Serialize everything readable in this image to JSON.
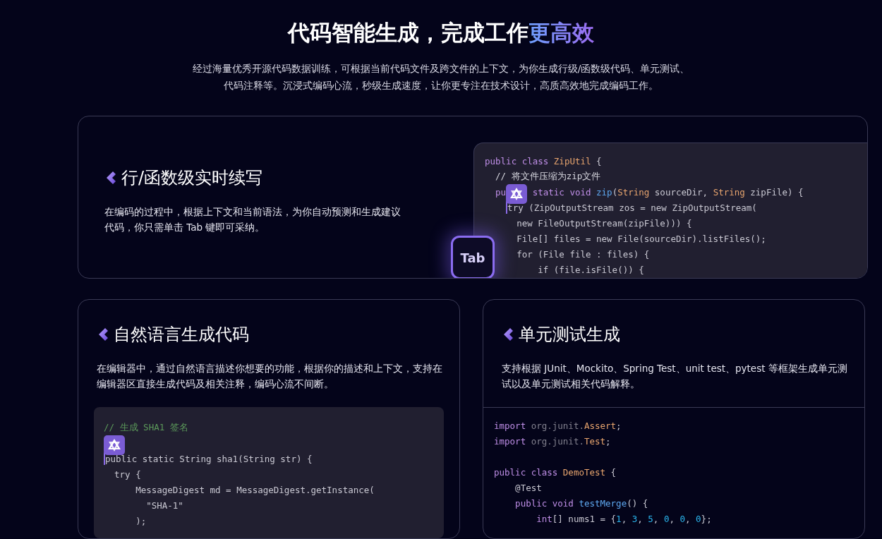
{
  "hero": {
    "title_parts": [
      {
        "text": "代码智能生成，完成工作",
        "highlight": false
      },
      {
        "text": "更高效",
        "highlight": true
      }
    ],
    "subtitle_lines": [
      "经过海量优秀开源代码数据训练，可根据当前代码文件及跨文件的上下文，为你生成行级/函数级代码、单元测试、",
      "代码注释等。沉浸式编码心流，秒级生成速度，让你更专注在技术设计，高质高效地完成编码工作。"
    ]
  },
  "feature_main": {
    "title": "行/函数级实时续写",
    "description": "在编码的过程中，根据上下文和当前语法，为你自动预测和生成建议代码，你只需单击 Tab 键即可采纳。",
    "key_label": "Tab",
    "code": [
      {
        "lines": [
          {
            "tokens": [
              {
                "text": "public class ",
                "kind": "kw"
              },
              {
                "text": "ZipUtil",
                "kind": "type"
              },
              {
                "text": " {",
                "kind": "plain"
              }
            ]
          },
          {
            "tokens": [
              {
                "text": "  // 将文件压缩为zip文件",
                "kind": "note"
              }
            ]
          },
          {
            "tokens": [
              {
                "text": "  pu",
                "kind": "kw"
              },
              {
                "kind": "badge"
              },
              {
                "text": " static void ",
                "kind": "kw"
              },
              {
                "text": "zip",
                "kind": "fn"
              },
              {
                "text": "(",
                "kind": "plain"
              },
              {
                "text": "String",
                "kind": "type"
              },
              {
                "text": " sourceDir, ",
                "kind": "plain"
              },
              {
                "text": "String",
                "kind": "type"
              },
              {
                "text": " zipFile) {",
                "kind": "plain"
              }
            ]
          },
          {
            "tokens": [
              {
                "text": "    try (ZipOutputStream zos = new ZipOutputStream(",
                "kind": "caret"
              }
            ]
          },
          {
            "tokens": [
              {
                "text": "      new FileOutputStream(zipFile))) {",
                "kind": "plain"
              }
            ]
          },
          {
            "tokens": [
              {
                "text": "      File[] files = new File(sourceDir).listFiles();",
                "kind": "plain"
              }
            ]
          },
          {
            "tokens": [
              {
                "text": "      for (File file : files) {",
                "kind": "plain"
              }
            ]
          },
          {
            "tokens": [
              {
                "text": "          if (file.isFile()) {",
                "kind": "plain"
              }
            ]
          }
        ]
      }
    ]
  },
  "features": [
    {
      "title": "自然语言生成代码",
      "description": "在编辑器中，通过自然语言描述你想要的功能，根据你的描述和上下文，支持在编辑器区直接生成代码及相关注释，编码心流不间断。",
      "kind": "panel",
      "code": [
        {
          "lines": [
            {
              "tokens": [
                {
                  "text": "// 生成 SHA1 签名",
                  "kind": "comment"
                }
              ]
            },
            {
              "tokens": [
                {
                  "kind": "badge"
                }
              ]
            },
            {
              "tokens": [
                {
                  "text": "public static String sha1(String str) {",
                  "kind": "caret"
                }
              ]
            },
            {
              "tokens": [
                {
                  "text": "  try {",
                  "kind": "plain"
                }
              ]
            },
            {
              "tokens": [
                {
                  "text": "      MessageDigest md = MessageDigest.getInstance(",
                  "kind": "plain"
                }
              ]
            },
            {
              "tokens": [
                {
                  "text": "        \"SHA-1\"",
                  "kind": "plain"
                }
              ]
            },
            {
              "tokens": [
                {
                  "text": "      );",
                  "kind": "plain"
                }
              ]
            }
          ]
        }
      ]
    },
    {
      "title": "单元测试生成",
      "description": "支持根据 JUnit、Mockito、Spring Test、unit test、pytest 等框架生成单元测试以及单元测试相关代码解释。",
      "kind": "divided",
      "code": [
        {
          "lines": [
            {
              "tokens": [
                {
                  "text": "import ",
                  "kind": "kw"
                },
                {
                  "text": "org.junit.",
                  "kind": "dim"
                },
                {
                  "text": "Assert",
                  "kind": "type"
                },
                {
                  "text": ";",
                  "kind": "plain"
                }
              ]
            },
            {
              "tokens": [
                {
                  "text": "import ",
                  "kind": "kw"
                },
                {
                  "text": "org.junit.",
                  "kind": "dim"
                },
                {
                  "text": "Test",
                  "kind": "type"
                },
                {
                  "text": ";",
                  "kind": "plain"
                }
              ]
            }
          ]
        },
        {
          "lines": [
            {
              "tokens": [
                {
                  "text": "public class ",
                  "kind": "kw"
                },
                {
                  "text": "DemoTest",
                  "kind": "type"
                },
                {
                  "text": " {",
                  "kind": "plain"
                }
              ]
            },
            {
              "tokens": [
                {
                  "text": "    @Test",
                  "kind": "plain"
                }
              ]
            },
            {
              "tokens": [
                {
                  "text": "    public void ",
                  "kind": "kw"
                },
                {
                  "text": "testMerge",
                  "kind": "fn"
                },
                {
                  "text": "() {",
                  "kind": "plain"
                }
              ]
            },
            {
              "tokens": [
                {
                  "text": "        int",
                  "kind": "kw"
                },
                {
                  "text": "[] nums1 = {",
                  "kind": "plain"
                },
                {
                  "text": "1",
                  "kind": "num"
                },
                {
                  "text": ", ",
                  "kind": "plain"
                },
                {
                  "text": "3",
                  "kind": "num"
                },
                {
                  "text": ", ",
                  "kind": "plain"
                },
                {
                  "text": "5",
                  "kind": "num"
                },
                {
                  "text": ", ",
                  "kind": "plain"
                },
                {
                  "text": "0",
                  "kind": "num"
                },
                {
                  "text": ", ",
                  "kind": "plain"
                },
                {
                  "text": "0",
                  "kind": "num"
                },
                {
                  "text": ", ",
                  "kind": "plain"
                },
                {
                  "text": "0",
                  "kind": "num"
                },
                {
                  "text": "};",
                  "kind": "plain"
                }
              ]
            }
          ]
        }
      ]
    }
  ]
}
